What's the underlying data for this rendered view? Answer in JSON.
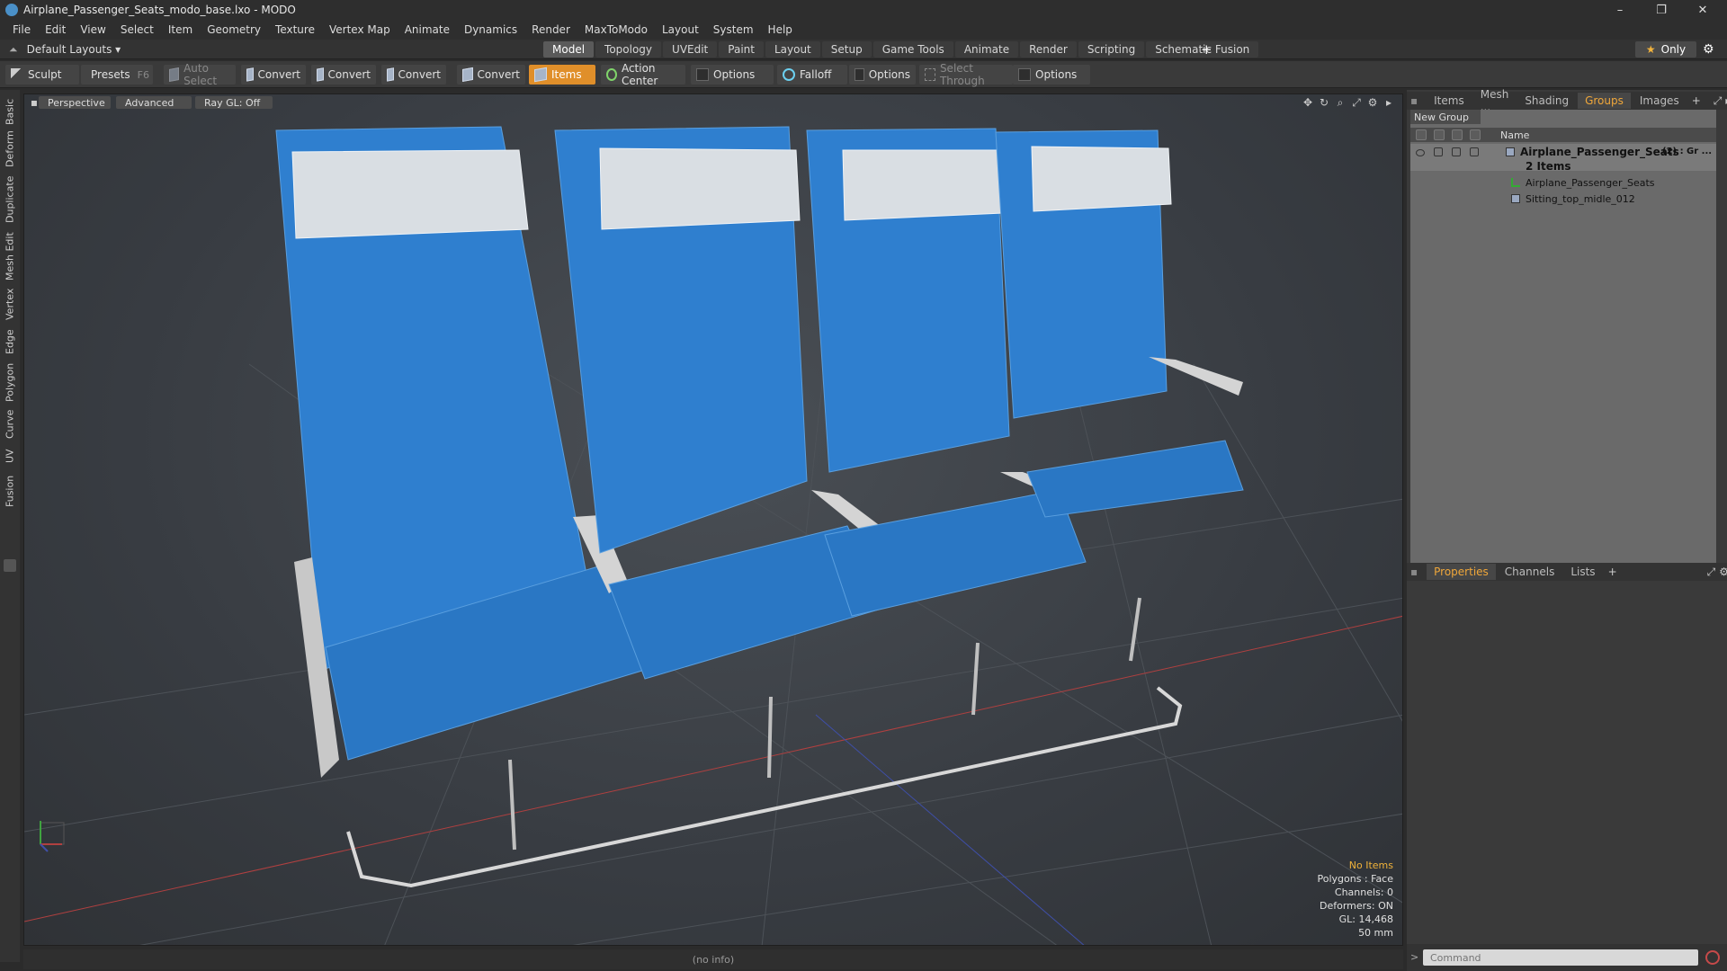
{
  "window": {
    "title": "Airplane_Passenger_Seats_modo_base.lxo - MODO",
    "controls": {
      "minimize": "–",
      "restore": "❐",
      "close": "✕"
    }
  },
  "menu": [
    "File",
    "Edit",
    "View",
    "Select",
    "Item",
    "Geometry",
    "Texture",
    "Vertex Map",
    "Animate",
    "Dynamics",
    "Render",
    "MaxToModo",
    "Layout",
    "System",
    "Help"
  ],
  "layoutbar": {
    "layouts_label": "Default Layouts ▾",
    "tabs": [
      "Model",
      "Topology",
      "UVEdit",
      "Paint",
      "Layout",
      "Setup",
      "Game Tools",
      "Animate",
      "Render",
      "Scripting",
      "Schematic Fusion"
    ],
    "active_tab": "Model",
    "plus": "+",
    "only_label": "Only",
    "star": "★",
    "gear": "⚙"
  },
  "toolbar": {
    "sculpt": "Sculpt",
    "presets": "Presets",
    "presets_key": "F6",
    "auto_select": "Auto Select",
    "convert1": "Convert",
    "convert2": "Convert",
    "convert3": "Convert",
    "convert4": "Convert",
    "items": "Items",
    "action_center": "Action Center",
    "options1": "Options",
    "falloff": "Falloff",
    "options2": "Options",
    "select_through": "Select Through",
    "options3": "Options"
  },
  "left_tabs": [
    "Basic",
    "Deform",
    "Duplicate",
    "Mesh Edit",
    "Vertex",
    "Edge",
    "Polygon",
    "Curve",
    "UV",
    "Fusion"
  ],
  "viewport": {
    "view_mode": "Perspective",
    "shading": "Advanced",
    "raygl": "Ray GL: Off",
    "info": {
      "selection": "No Items",
      "polygons": "Polygons : Face",
      "channels": "Channels: 0",
      "deformers": "Deformers: ON",
      "gl": "GL: 14,468",
      "distance": "50 mm"
    }
  },
  "status_text": "(no info)",
  "right_panel": {
    "top_tabs": [
      "Items",
      "Mesh ...",
      "Shading",
      "Groups",
      "Images"
    ],
    "active_top_tab": "Groups",
    "new_group": "New Group",
    "name_header": "Name",
    "tree": {
      "group_name": "Airplane_Passenger_Seats",
      "group_suffix": "(2) : Gr ...",
      "group_count": "2 Items",
      "child1": "Airplane_Passenger_Seats",
      "child2": "Sitting_top_midle_012"
    },
    "bottom_tabs": [
      "Properties",
      "Channels",
      "Lists"
    ],
    "active_bottom_tab": "Properties",
    "command_placeholder": "Command"
  },
  "colors": {
    "accent": "#e08f2a",
    "seat_blue": "#2f7fcf",
    "headrest": "#d9dee3",
    "frame": "#d0d0d0"
  }
}
